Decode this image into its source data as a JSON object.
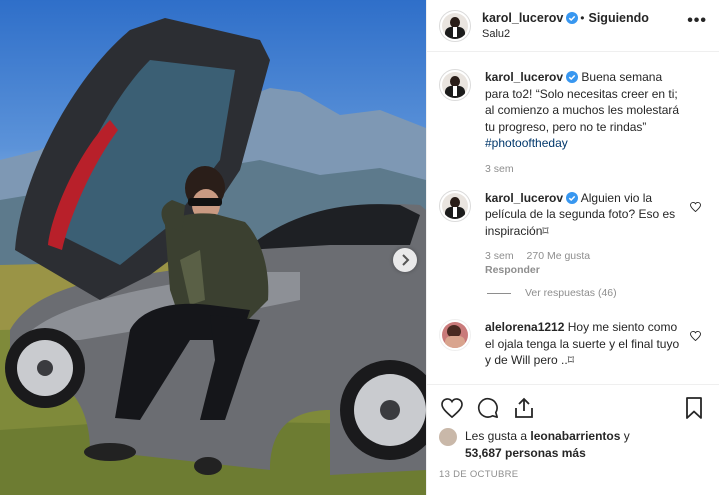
{
  "header": {
    "username": "karol_lucerov",
    "separator": "•",
    "follow_status": "Siguiendo",
    "location": "Salu2",
    "more_label": "•••"
  },
  "comments": [
    {
      "username": "karol_lucerov",
      "text": "Buena semana para to2! “Solo necesitas creer en ti; al comienzo a muchos les molestará tu progreso, pero no te rindas”",
      "hashtag": "#photooftheday",
      "time": "3 sem"
    },
    {
      "username": "karol_lucerov",
      "text": "Alguien vio la película de la segunda foto? Eso es inspiración⌑",
      "time": "3 sem",
      "likes": "270 Me gusta",
      "reply": "Responder",
      "view_replies": "Ver respuestas (46)"
    },
    {
      "username": "alelorena1212",
      "text": "Hoy me siento como el ojala tenga la suerte y el final tuyo y de Will pero ..⌑"
    }
  ],
  "likes": {
    "prefix": "Les gusta a",
    "liker": "leonabarrientos",
    "and": "y",
    "count": "53,687 personas más"
  },
  "date": "13 DE OCTUBRE",
  "colors": {
    "verified": "#3897f0",
    "hashtag": "#00376b",
    "muted": "#8e8e8e"
  },
  "icons": [
    "heart-icon",
    "comment-icon",
    "share-icon",
    "bookmark-icon",
    "chevron-right-icon",
    "verified-badge-icon"
  ]
}
